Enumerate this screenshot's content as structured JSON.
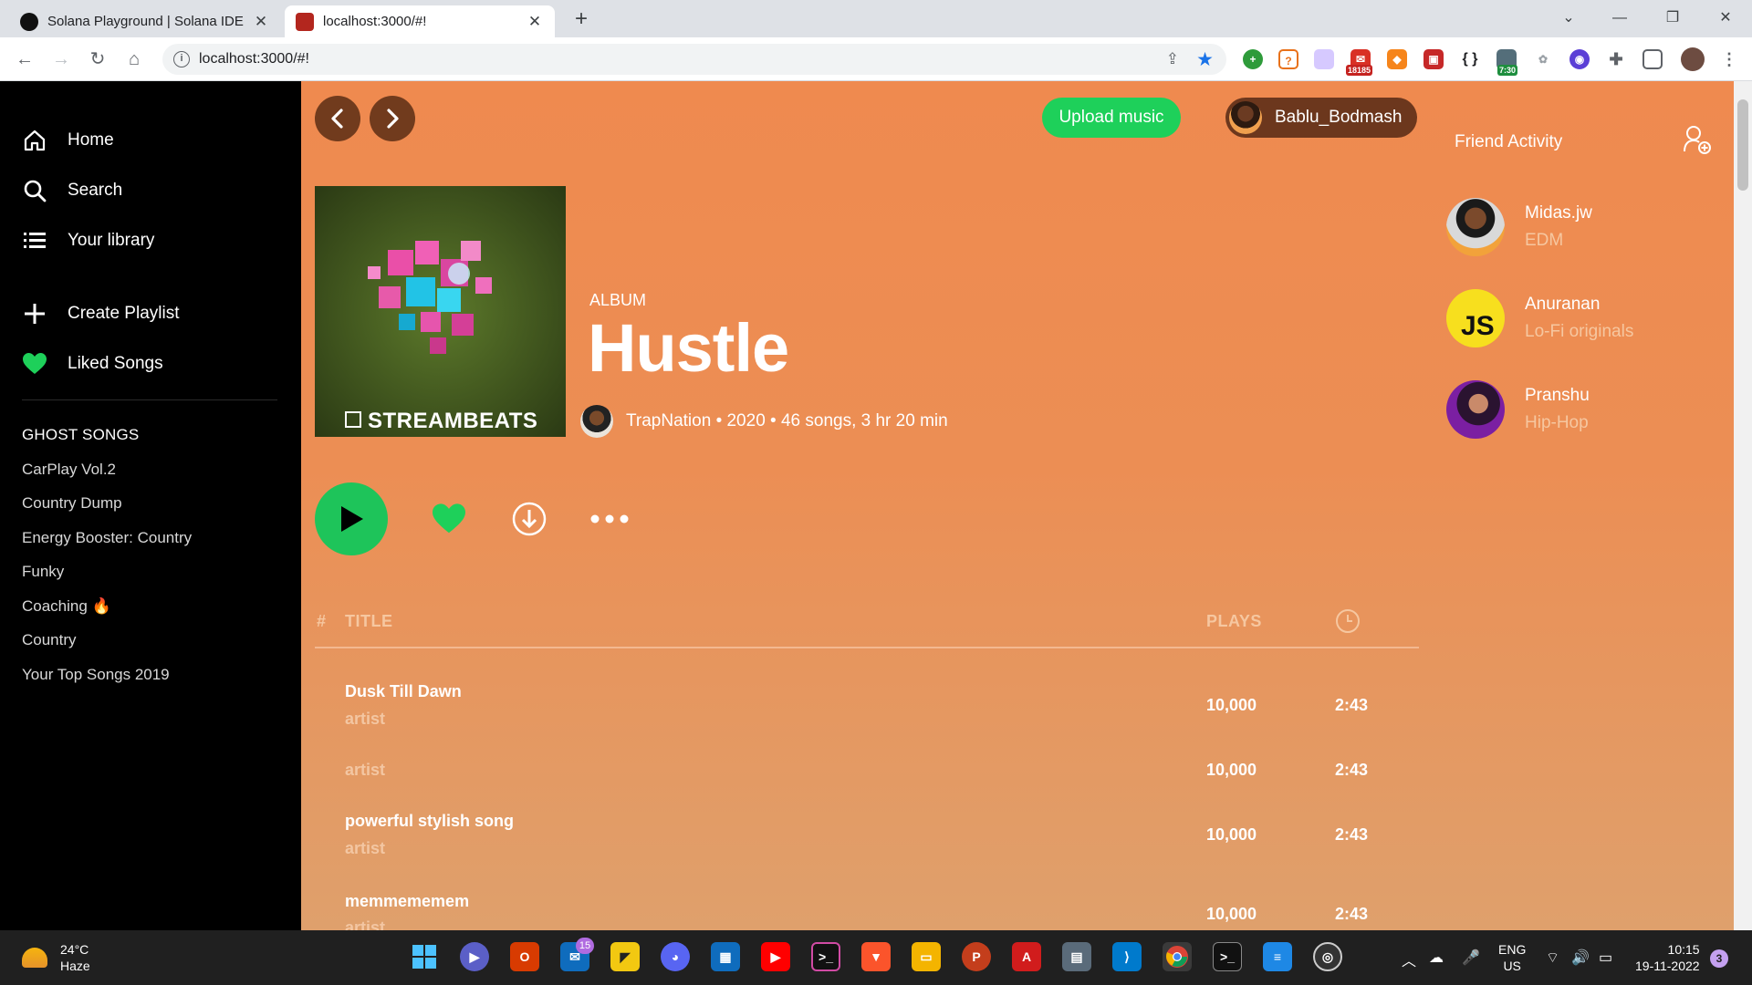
{
  "browser": {
    "tabs": [
      {
        "title": "Solana Playground | Solana IDE",
        "active": false
      },
      {
        "title": "localhost:3000/#!",
        "active": true
      }
    ],
    "url": "localhost:3000/#!",
    "extension_badges": {
      "mail_count": "18185",
      "timer": "7:30"
    }
  },
  "sidebar": {
    "nav": [
      {
        "label": "Home",
        "icon": "home-icon"
      },
      {
        "label": "Search",
        "icon": "search-icon"
      },
      {
        "label": "Your library",
        "icon": "library-icon"
      }
    ],
    "actions": [
      {
        "label": "Create Playlist",
        "icon": "plus-icon"
      },
      {
        "label": "Liked Songs",
        "icon": "heart-icon"
      }
    ],
    "section_title": "GHOST SONGS",
    "playlists": [
      "CarPlay Vol.2",
      "Country Dump",
      "Energy Booster: Country",
      "Funky",
      "Coaching 🔥",
      "Country",
      "Your Top Songs 2019"
    ]
  },
  "header": {
    "upload_label": "Upload music",
    "username": "Bablu_Bodmash"
  },
  "album": {
    "type_label": "ALBUM",
    "title": "Hustle",
    "cover_text": "STREAMBEATS",
    "meta": "TrapNation • 2020 • 46 songs, 3 hr 20 min"
  },
  "tracklist": {
    "headers": {
      "number": "#",
      "title": "TITLE",
      "plays": "PLAYS"
    },
    "rows": [
      {
        "title": "Dusk Till Dawn",
        "artist": "artist",
        "plays": "10,000",
        "duration": "2:43"
      },
      {
        "title": "",
        "artist": "artist",
        "plays": "10,000",
        "duration": "2:43"
      },
      {
        "title": "powerful stylish song",
        "artist": "artist",
        "plays": "10,000",
        "duration": "2:43"
      },
      {
        "title": "memmememem",
        "artist": "artist",
        "plays": "10,000",
        "duration": "2:43"
      }
    ]
  },
  "friend_activity": {
    "title": "Friend Activity",
    "friends": [
      {
        "name": "Midas.jw",
        "genre": "EDM",
        "avatar_text": ""
      },
      {
        "name": "Anuranan",
        "genre": "Lo-Fi originals",
        "avatar_text": "JS"
      },
      {
        "name": "Pranshu",
        "genre": "Hip-Hop",
        "avatar_text": ""
      }
    ]
  },
  "colors": {
    "accent_green": "#1ed05a",
    "main_gradient_top": "#ef8a4f",
    "main_gradient_bottom": "#dfa06c",
    "sidebar_bg": "#000000"
  },
  "taskbar": {
    "weather_temp": "24°C",
    "weather_desc": "Haze",
    "mail_badge": "15",
    "lang_1": "ENG",
    "lang_2": "US",
    "time": "10:15",
    "date": "19-11-2022",
    "notification_count": "3"
  }
}
